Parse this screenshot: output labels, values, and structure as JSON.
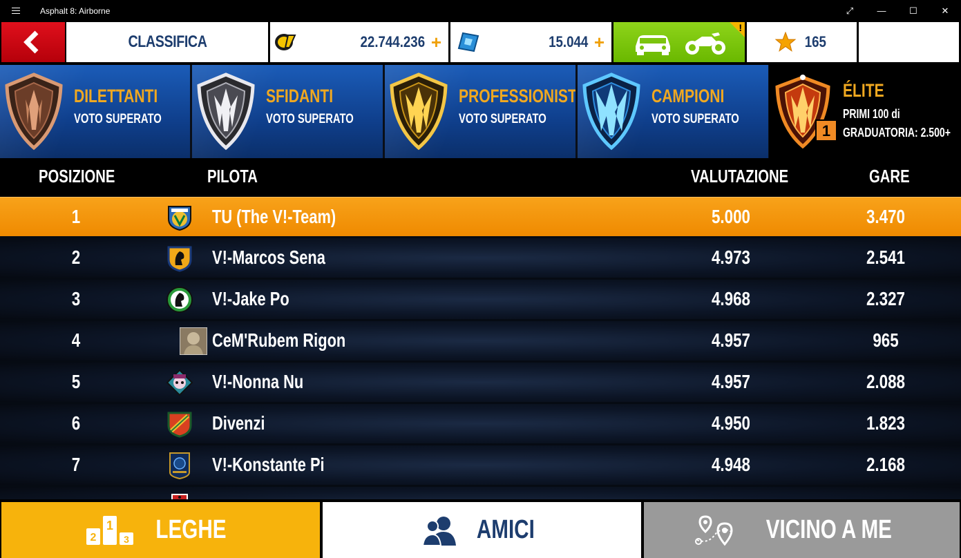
{
  "window": {
    "title": "Asphalt 8: Airborne",
    "controls": {
      "restore": "⤢",
      "minimize": "—",
      "maximize": "☐",
      "close": "✕"
    }
  },
  "topbar": {
    "screen_title": "CLASSIFICA",
    "credits": "22.744.236",
    "tokens": "15.044",
    "plus": "+",
    "stars": "165",
    "garage_alert": "!"
  },
  "leagues": [
    {
      "name": "DILETTANTI",
      "status": "VOTO SUPERATO"
    },
    {
      "name": "SFIDANTI",
      "status": "VOTO SUPERATO"
    },
    {
      "name": "PROFESSIONISTI",
      "status": "VOTO SUPERATO"
    },
    {
      "name": "CAMPIONI",
      "status": "VOTO SUPERATO"
    },
    {
      "name": "ÉLITE",
      "line1": "PRIMI 100 di",
      "line2": "GRADUATORIA: 2.500+",
      "rank_badge": "1"
    }
  ],
  "table": {
    "headers": {
      "position": "POSIZIONE",
      "driver": "PILOTA",
      "rating": "VALUTAZIONE",
      "races": "GARE"
    },
    "rows": [
      {
        "pos": "1",
        "name": "TU (The V!-Team)",
        "rating": "5.000",
        "races": "3.470"
      },
      {
        "pos": "2",
        "name": "V!-Marcos Sena",
        "rating": "4.973",
        "races": "2.541"
      },
      {
        "pos": "3",
        "name": "V!-Jake Po",
        "rating": "4.968",
        "races": "2.327"
      },
      {
        "pos": "4",
        "name": "CeM'Rubem Rigon",
        "rating": "4.957",
        "races": "965"
      },
      {
        "pos": "5",
        "name": "V!-Nonna Nu",
        "rating": "4.957",
        "races": "2.088"
      },
      {
        "pos": "6",
        "name": "Divenzi",
        "rating": "4.950",
        "races": "1.823"
      },
      {
        "pos": "7",
        "name": "V!-Konstante Pi",
        "rating": "4.948",
        "races": "2.168"
      }
    ]
  },
  "tabs": {
    "leagues": "LEGHE",
    "friends": "AMICI",
    "nearby": "VICINO A ME"
  },
  "podium": {
    "first": "1",
    "second": "2",
    "third": "3"
  },
  "colors": {
    "accent": "#f7b30c",
    "brand_blue": "#1d3d6e",
    "highlight_row": "#f39410",
    "back_red": "#d40b16"
  }
}
